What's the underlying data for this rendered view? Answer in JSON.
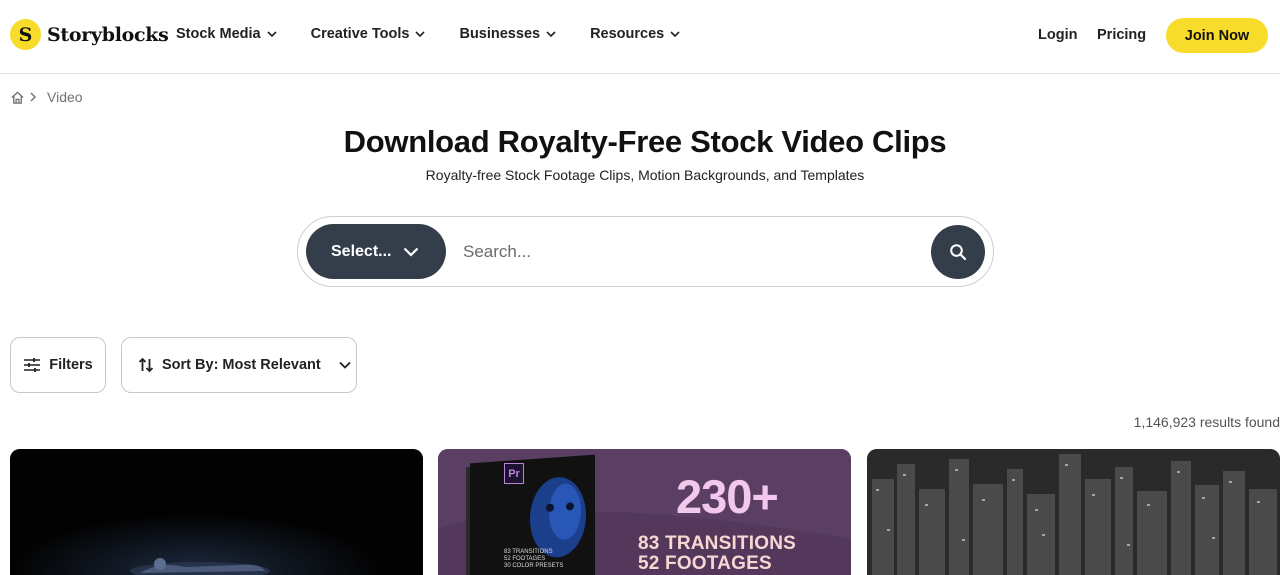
{
  "brand": {
    "logo_letter": "S",
    "name": "Storyblocks",
    "accent": "#f8dc2b",
    "dark": "#343e4b"
  },
  "nav": {
    "items": [
      {
        "label": "Stock Media"
      },
      {
        "label": "Creative Tools"
      },
      {
        "label": "Businesses"
      },
      {
        "label": "Resources"
      }
    ],
    "login": "Login",
    "pricing": "Pricing",
    "join": "Join Now"
  },
  "breadcrumb": {
    "current": "Video"
  },
  "hero": {
    "title": "Download Royalty-Free Stock Video Clips",
    "subtitle": "Royalty-free Stock Footage Clips, Motion Backgrounds, and Templates"
  },
  "search": {
    "select_label": "Select...",
    "placeholder": "Search..."
  },
  "toolbar": {
    "filters_label": "Filters",
    "sort_label": "Sort By: Most Relevant"
  },
  "results": {
    "count_text": "1,146,923 results found"
  },
  "cards": {
    "promo": {
      "badge": "Pr",
      "headline": "230+",
      "line1": "83 TRANSITIONS",
      "line2": "52 FOOTAGES",
      "box_lines": [
        "83 TRANSITIONS",
        "52 FOOTAGES",
        "30 COLOR PRESETS"
      ]
    }
  }
}
